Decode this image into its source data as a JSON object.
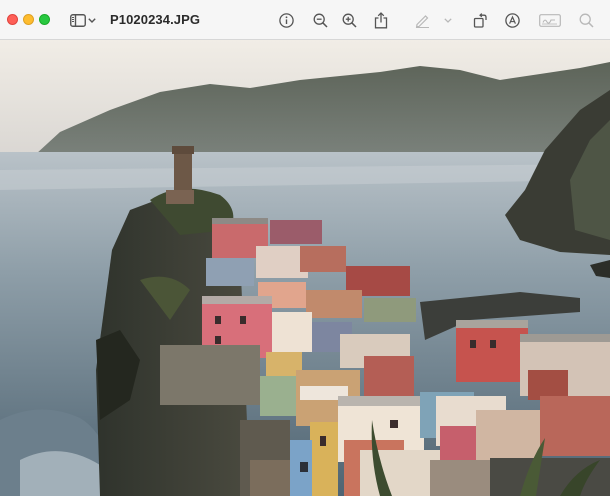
{
  "window": {
    "title": "P1020234.JPG"
  },
  "toolbar": {
    "buttons": [
      {
        "name": "sidebar-toggle",
        "icon": "sidebar-icon"
      },
      {
        "name": "sidebar-menu",
        "icon": "chevron-down-icon"
      },
      {
        "name": "info",
        "icon": "info-icon"
      },
      {
        "name": "zoom-out",
        "icon": "zoom-out-icon"
      },
      {
        "name": "zoom-in",
        "icon": "zoom-in-icon"
      },
      {
        "name": "share",
        "icon": "share-icon"
      },
      {
        "name": "markup-pen",
        "icon": "pen-icon",
        "disabled": true
      },
      {
        "name": "markup-menu",
        "icon": "chevron-down-icon",
        "disabled": true
      },
      {
        "name": "rotate",
        "icon": "rotate-icon"
      },
      {
        "name": "markup",
        "icon": "markup-circle-icon"
      },
      {
        "name": "form-fill",
        "icon": "signature-icon",
        "disabled": true
      },
      {
        "name": "search",
        "icon": "search-icon",
        "disabled": true
      }
    ]
  },
  "image": {
    "description_icon": "photo-coastal-village"
  },
  "colors": {
    "toolbar_bg": "#f6f6f6",
    "icon": "#555555",
    "icon_disabled": "#b8b8b8",
    "close": "#fe5f57",
    "minimize": "#febc2e",
    "maximize": "#28c840"
  }
}
